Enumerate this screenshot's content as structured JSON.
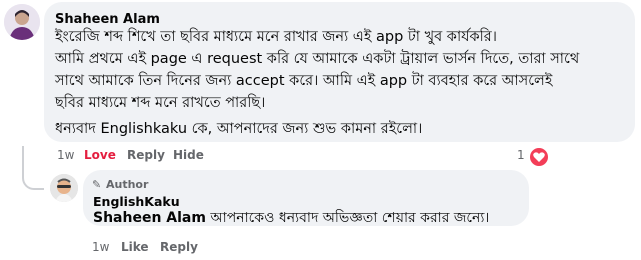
{
  "comment": {
    "author": "Shaheen Alam",
    "lines": [
      "ইংরেজি শব্দ শিখে তা ছবির মাধ্যমে মনে রাখার জন্য এই app টা খুব কার্যকরি।",
      "আমি প্রথমে এই page এ request করি যে আমাকে একটা ট্রায়াল ভার্সন দিতে, তারা সাথে",
      "সাথে আমাকে তিন দিনের জন্য accept করে। আমি এই app টা ব্যবহার করে আসলেই",
      "ছবির মাধ্যমে শব্দ মনে রাখতে পারছি।",
      "ধন্যবাদ Englishkaku কে, আপনাদের জন্য শুভ কামনা রইলো।"
    ],
    "time": "1w",
    "love_label": "Love",
    "reply_label": "Reply",
    "hide_label": "Hide",
    "reaction_count": "1"
  },
  "reply": {
    "author_tag": "Author",
    "author": "EnglishKaku",
    "mention": "Shaheen Alam",
    "text": " আপনাকেও ধন্যবাদ অভিজ্ঞতা শেয়ার করার জন্যে।",
    "time": "1w",
    "like_label": "Like",
    "reply_label": "Reply"
  },
  "colors": {
    "bubble": "#f0f2f5",
    "meta": "#65676b",
    "love": "#e41e3f",
    "heart": "#f33e58"
  }
}
